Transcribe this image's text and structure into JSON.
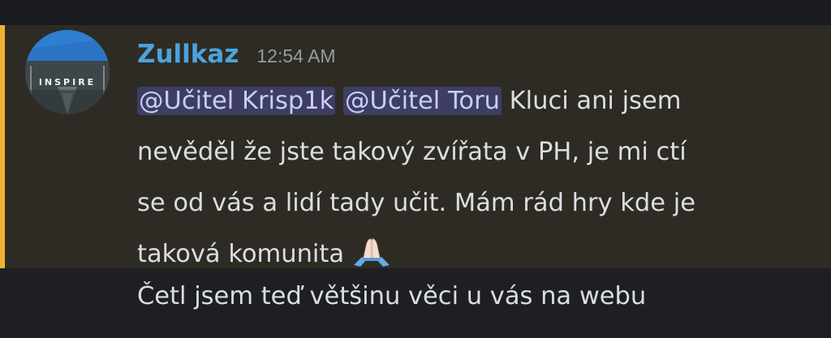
{
  "message": {
    "author": "Zullkaz",
    "timestamp": "12:54 AM",
    "avatar_text": "INSPIRE",
    "mentions": [
      "@Učitel Krisp1k",
      "@Učitel Toru"
    ],
    "text_line1": " Kluci ani jsem",
    "text_line2": "nevěděl že jste takový zvířata v PH, je mi ctí",
    "text_line3": "se od vás a lidí tady učit. Mám rád hry kde je",
    "text_line4": "taková komunita",
    "emoji": "folded-hands-emoji",
    "highlight_color": "#f0b232",
    "mention_color": "#c9cdfb",
    "author_color": "#4ba3dc"
  },
  "followup": {
    "text": "Četl jsem teď většinu věci u vás na webu"
  }
}
